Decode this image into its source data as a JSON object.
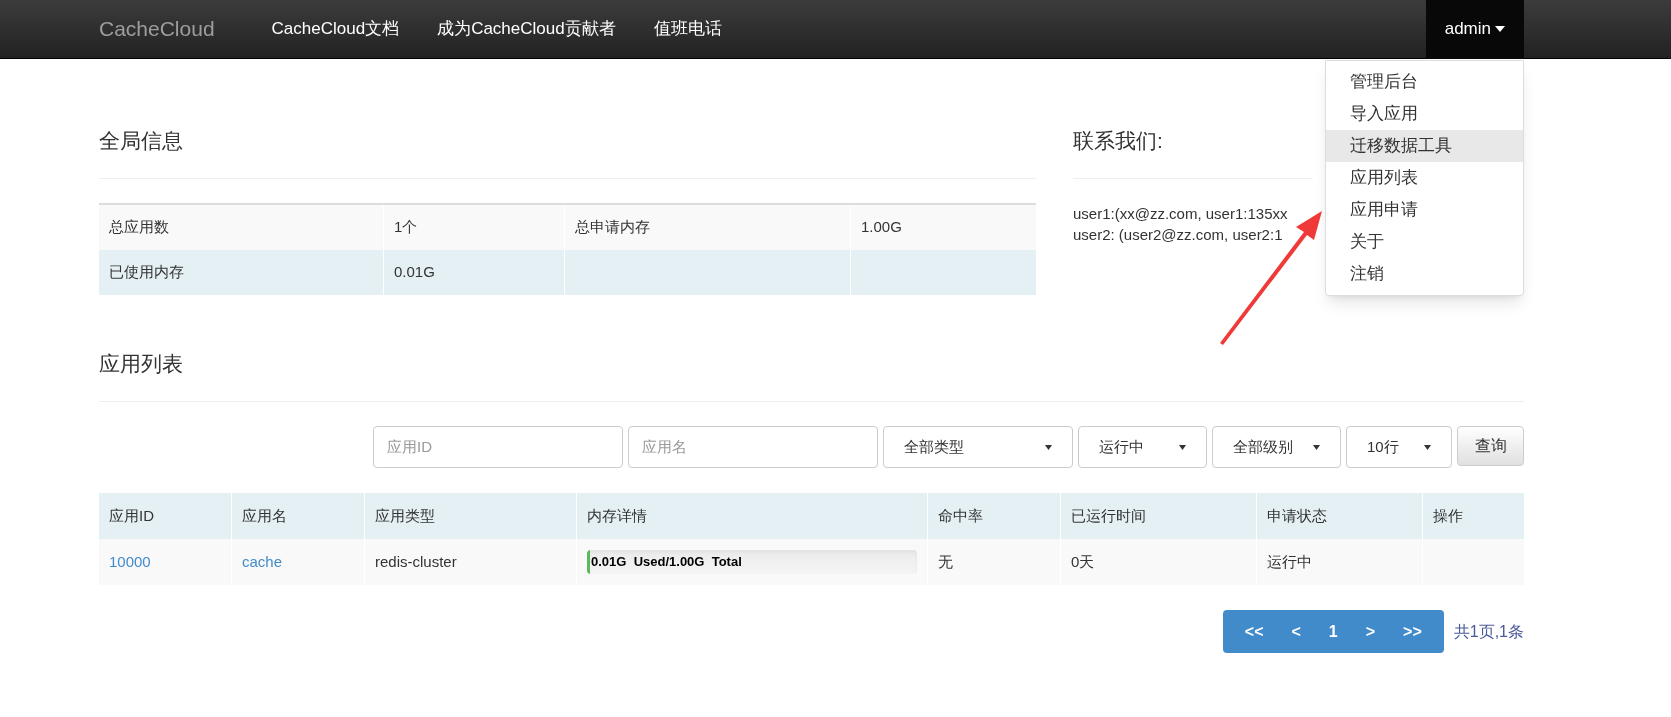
{
  "navbar": {
    "brand": "CacheCloud",
    "links": [
      "CacheCloud文档",
      "成为CacheCloud贡献者",
      "值班电话"
    ],
    "user_menu": {
      "label": "admin",
      "expanded": true,
      "items": [
        {
          "label": "管理后台",
          "selected": false
        },
        {
          "label": "导入应用",
          "selected": false
        },
        {
          "label": "迁移数据工具",
          "selected": true
        },
        {
          "label": "应用列表",
          "selected": false
        },
        {
          "label": "应用申请",
          "selected": false
        },
        {
          "label": "关于",
          "selected": false
        },
        {
          "label": "注销",
          "selected": false
        }
      ]
    }
  },
  "global_info": {
    "title": "全局信息",
    "rows": [
      [
        "总应用数",
        "1个",
        "总申请内存",
        "1.00G"
      ],
      [
        "已使用内存",
        "0.01G",
        "",
        ""
      ]
    ]
  },
  "contact": {
    "title": "联系我们:",
    "lines": [
      "user1:(xx@zz.com, user1:135xx",
      "user2: (user2@zz.com, user2:1"
    ]
  },
  "app_list": {
    "title": "应用列表",
    "filters": [
      {
        "kind": "input",
        "placeholder": "应用ID"
      },
      {
        "kind": "input",
        "placeholder": "应用名"
      },
      {
        "kind": "select",
        "value": "全部类型"
      },
      {
        "kind": "select",
        "value": "运行中"
      },
      {
        "kind": "select",
        "value": "全部级别"
      },
      {
        "kind": "select",
        "value": "10行"
      }
    ],
    "query_button": "查询",
    "columns": [
      "应用ID",
      "应用名",
      "应用类型",
      "内存详情",
      "命中率",
      "已运行时间",
      "申请状态",
      "操作"
    ],
    "rows": [
      {
        "id": "10000",
        "name": "cache",
        "type": "redis-cluster",
        "memory": {
          "level": 0.01,
          "used": "0.01G",
          "used_label": "Used/1.00G",
          "total_label": "Total"
        },
        "hit_rate": "无",
        "uptime": "0天",
        "status": "运行中"
      }
    ],
    "pagination": {
      "buttons": [
        "<<",
        "<",
        "1",
        ">",
        ">>"
      ],
      "summary": "共1页,1条"
    }
  }
}
